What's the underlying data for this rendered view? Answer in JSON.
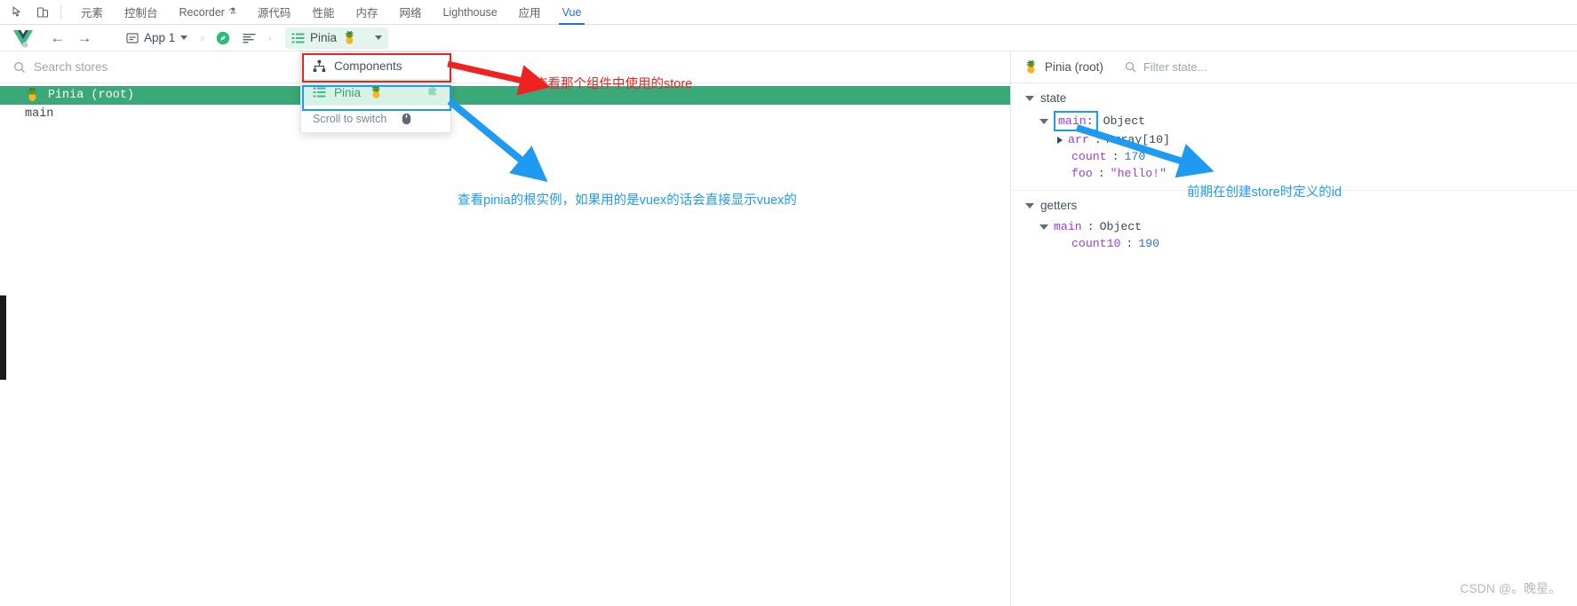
{
  "devtools": {
    "icons": [
      {
        "name": "inspect-element-icon",
        "glyph": "⬉"
      },
      {
        "name": "device-toolbar-icon",
        "glyph": "▯"
      }
    ],
    "tabs": [
      {
        "label": "元素",
        "active": false,
        "warn": false
      },
      {
        "label": "控制台",
        "active": false,
        "warn": false
      },
      {
        "label": "Recorder",
        "active": false,
        "warn": true
      },
      {
        "label": "源代码",
        "active": false,
        "warn": false
      },
      {
        "label": "性能",
        "active": false,
        "warn": false
      },
      {
        "label": "内存",
        "active": false,
        "warn": false
      },
      {
        "label": "网络",
        "active": false,
        "warn": false
      },
      {
        "label": "Lighthouse",
        "active": false,
        "warn": false
      },
      {
        "label": "应用",
        "active": false,
        "warn": false
      },
      {
        "label": "Vue",
        "active": true,
        "warn": false
      }
    ],
    "warn_glyph": "⚗"
  },
  "toolbar": {
    "logo_name": "vue-logo",
    "back_glyph": "←",
    "forward_glyph": "→",
    "app_selector": {
      "label": "App 1",
      "icon": "app-window-icon"
    },
    "separator_glyph": "›",
    "compass_icon": "compass-icon",
    "timeline_icon": "timeline-icon",
    "current_plugin": {
      "label": "Pinia",
      "emoji": "🍍",
      "icon": "list-icon"
    },
    "dropdown_caret": "chevron-down-icon"
  },
  "dropdown": {
    "items": [
      {
        "label": "Components",
        "icon": "components-tree-icon",
        "selected": false,
        "emoji": ""
      },
      {
        "label": "Pinia",
        "icon": "list-icon",
        "selected": true,
        "emoji": "🍍",
        "badge": "puzzle-icon"
      }
    ],
    "footer": {
      "label": "Scroll to switch",
      "icon": "mouse-icon"
    }
  },
  "stores_panel": {
    "search": {
      "placeholder": "Search stores",
      "icon": "search-icon"
    },
    "items": [
      {
        "label": "Pinia (root)",
        "emoji": "🍍",
        "selected": true
      },
      {
        "label": "main",
        "emoji": "",
        "selected": false
      }
    ]
  },
  "state_panel": {
    "title": "Pinia (root)",
    "title_emoji": "🍍",
    "filter": {
      "placeholder": "Filter state...",
      "icon": "search-icon"
    },
    "sections": [
      {
        "name": "state",
        "expanded": true,
        "root": {
          "key": "main",
          "value": "Object",
          "expanded": true,
          "highlighted": true,
          "children": [
            {
              "key": "arr",
              "value": "Array[10]",
              "expanded": false,
              "expandable": true,
              "type": "ref"
            },
            {
              "key": "count",
              "value": "170",
              "expandable": false,
              "type": "number"
            },
            {
              "key": "foo",
              "value": "\"hello!\"",
              "expandable": false,
              "type": "string"
            }
          ]
        }
      },
      {
        "name": "getters",
        "expanded": true,
        "root": {
          "key": "main",
          "value": "Object",
          "expanded": true,
          "highlighted": false,
          "children": [
            {
              "key": "count10",
              "value": "190",
              "expandable": false,
              "type": "number"
            }
          ]
        }
      }
    ]
  },
  "annotations": [
    {
      "id": "red-note",
      "text": "查看那个组件中使用的store",
      "color": "#ef2222"
    },
    {
      "id": "blue-note-left",
      "text": "查看pinia的根实例，如果用的是vuex的话会直接显示vuex的",
      "color": "#1e9bf0"
    },
    {
      "id": "blue-note-right",
      "text": "前期在创建store时定义的id",
      "color": "#1e9bf0"
    }
  ],
  "watermark": {
    "text": "CSDN @。晚星。"
  },
  "colors": {
    "accent_green": "#42b883",
    "selected_green": "#3aa877",
    "menu_green": "#d9f2e8",
    "red": "#ef2222",
    "blue": "#1e9bf0",
    "tab_blue": "#1a73e8"
  }
}
